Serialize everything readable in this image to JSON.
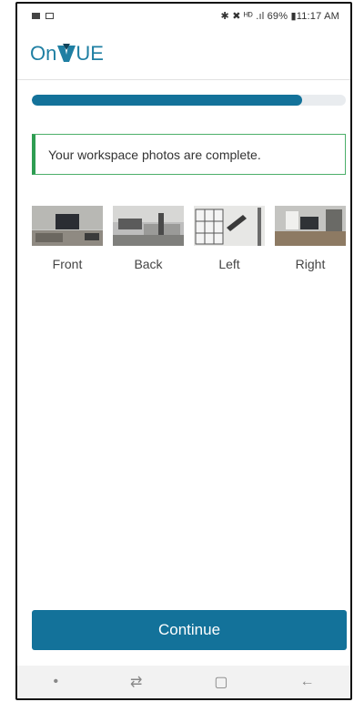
{
  "status_bar": {
    "right_text": "✱ ✖ ᴴᴰ .ıl 69% ▮11:17 AM"
  },
  "app": {
    "logo_text_left": "On",
    "logo_text_right": "UE"
  },
  "progress": {
    "value_percent": 86
  },
  "alert": {
    "message": "Your workspace photos are complete."
  },
  "photos": [
    {
      "label": "Front"
    },
    {
      "label": "Back"
    },
    {
      "label": "Left"
    },
    {
      "label": "Right"
    }
  ],
  "actions": {
    "continue_label": "Continue"
  },
  "nav": {
    "dot": "•",
    "recents": "⇄",
    "home": "▢",
    "back": "←"
  },
  "colors": {
    "primary": "#13729a",
    "success": "#2e9d52",
    "logo": "#1f7fa3"
  }
}
